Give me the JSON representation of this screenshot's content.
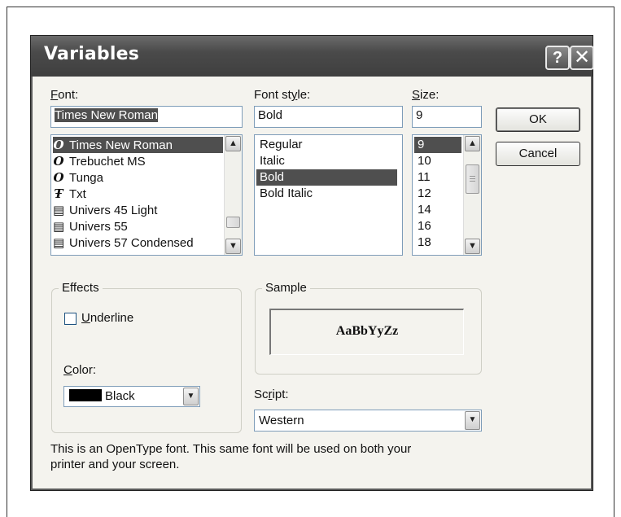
{
  "dialog": {
    "title": "Variables",
    "help_button": "?",
    "close_button": "✕"
  },
  "font": {
    "label_prefix": "",
    "label_mnemonic": "F",
    "label_rest": "ont:",
    "value": "Times New Roman",
    "items": [
      {
        "label": "Times New Roman",
        "icon": "opentype-font-icon",
        "glyph": "O"
      },
      {
        "label": "Trebuchet MS",
        "icon": "opentype-font-icon",
        "glyph": "O"
      },
      {
        "label": "Tunga",
        "icon": "opentype-font-icon",
        "glyph": "O"
      },
      {
        "label": "Txt",
        "icon": "truetype-font-icon",
        "glyph": "Ŧ"
      },
      {
        "label": "Univers 45 Light",
        "icon": "printer-font-icon",
        "glyph": "▤"
      },
      {
        "label": "Univers 55",
        "icon": "printer-font-icon",
        "glyph": "▤"
      },
      {
        "label": "Univers 57 Condensed",
        "icon": "printer-font-icon",
        "glyph": "▤"
      }
    ],
    "selected_index": 0
  },
  "font_style": {
    "label_prefix": "Font st",
    "label_mnemonic": "y",
    "label_rest": "le:",
    "value": "Bold",
    "items": [
      "Regular",
      "Italic",
      "Bold",
      "Bold Italic"
    ],
    "selected_index": 2
  },
  "size": {
    "label_prefix": "",
    "label_mnemonic": "S",
    "label_rest": "ize:",
    "value": "9",
    "items": [
      "9",
      "10",
      "11",
      "12",
      "14",
      "16",
      "18"
    ],
    "selected_index": 0
  },
  "buttons": {
    "ok": "OK",
    "cancel": "Cancel"
  },
  "effects": {
    "legend": "Effects",
    "underline_mnemonic": "U",
    "underline_rest": "nderline",
    "underline_checked": false,
    "color_label_mnemonic": "C",
    "color_label_rest": "olor:",
    "color_value": "Black",
    "color_hex": "#000000"
  },
  "sample": {
    "legend": "Sample",
    "text": "AaBbYyZz"
  },
  "script": {
    "label_prefix": "Sc",
    "label_mnemonic": "r",
    "label_rest": "ipt:",
    "value": "Western"
  },
  "description": {
    "line1": "This is an OpenType font. This same font will be used on both your",
    "line2": "printer and your screen."
  }
}
